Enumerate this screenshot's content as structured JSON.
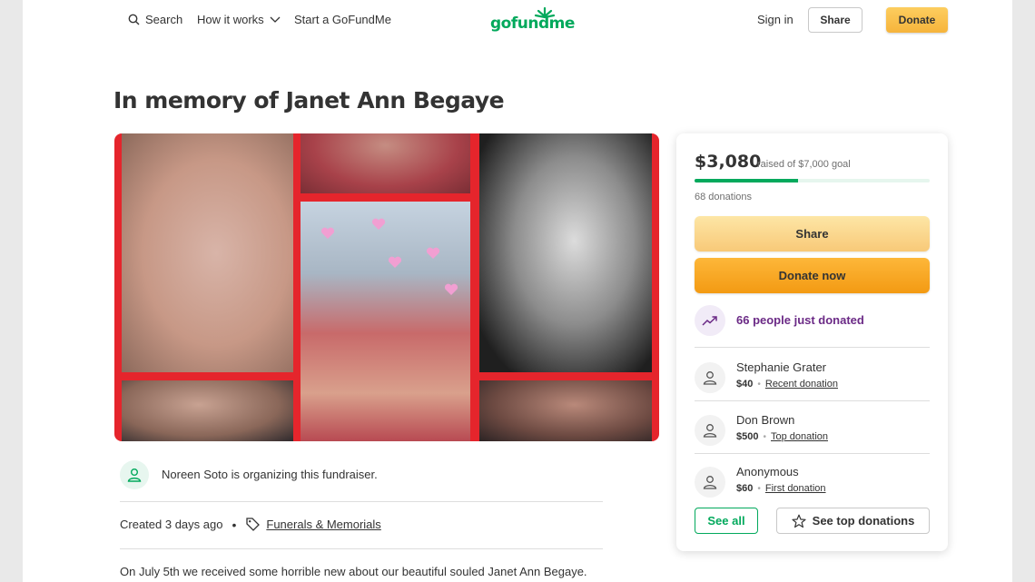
{
  "header": {
    "search_label": "Search",
    "how_it_works_label": "How it works",
    "start_label": "Start a GoFundMe",
    "logo_text": "gofundme",
    "sign_in_label": "Sign in",
    "share_label": "Share",
    "donate_label": "Donate"
  },
  "title": "In memory of Janet Ann Begaye",
  "organizer": {
    "text": "Noreen Soto is organizing this fundraiser."
  },
  "meta": {
    "created": "Created 3 days ago",
    "separator": "•",
    "category": "Funerals & Memorials"
  },
  "story": {
    "first_line": "On July 5th we received some horrible new about our beautiful souled Janet Ann Begaye."
  },
  "card": {
    "raised": "$3,080",
    "goal_text": "raised of $7,000 goal",
    "progress_fraction": 0.44,
    "donations_count": "68 donations",
    "share_label": "Share",
    "donate_now_label": "Donate now",
    "recent_activity": "66 people just donated",
    "donors": [
      {
        "name": "Stephanie Grater",
        "amount": "$40",
        "tag": "Recent donation"
      },
      {
        "name": "Don Brown",
        "amount": "$500",
        "tag": "Top donation"
      },
      {
        "name": "Anonymous",
        "amount": "$60",
        "tag": "First donation"
      }
    ],
    "meta_dot": "•",
    "see_all_label": "See all",
    "see_top_label": "See top donations"
  },
  "colors": {
    "brand_green": "#02a95c",
    "donate_orange": "#f6b43b",
    "activity_purple": "#6b2a86",
    "collage_border_red": "#e5252c"
  },
  "icons": [
    "search-icon",
    "chevron-down-icon",
    "sprout-logo-icon",
    "person-icon",
    "tag-icon",
    "trending-up-icon",
    "star-icon"
  ]
}
